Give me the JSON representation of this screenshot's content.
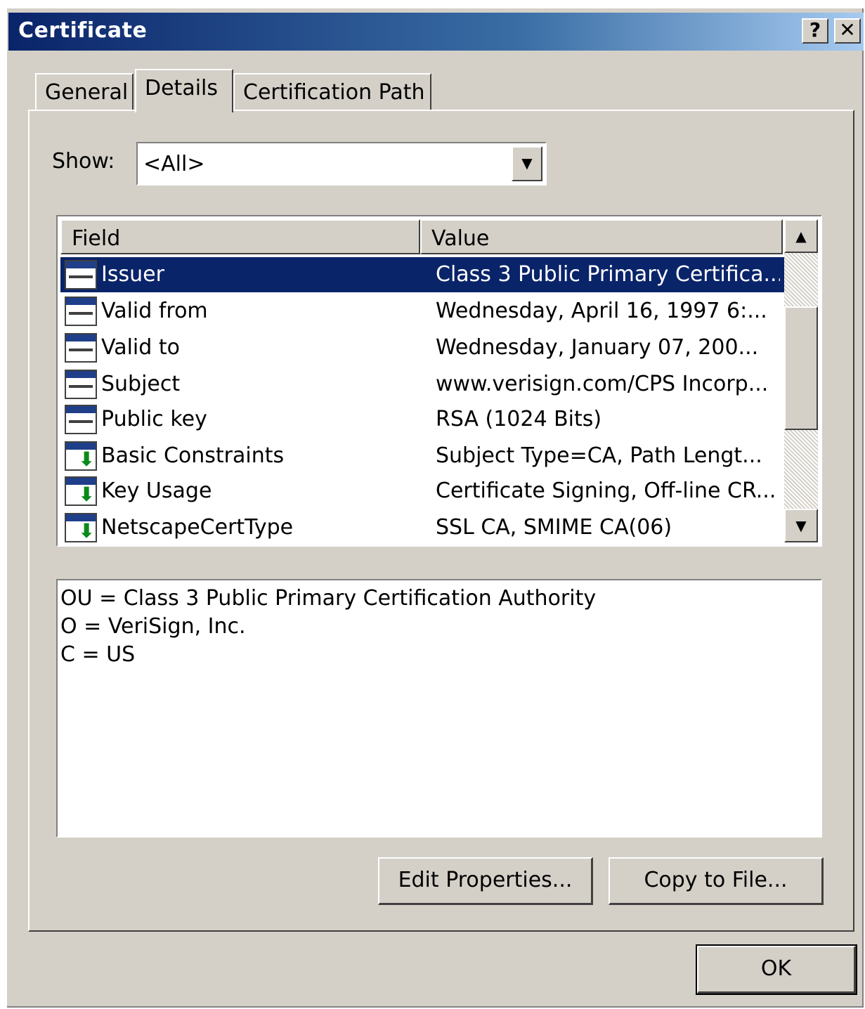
{
  "window": {
    "title": "Certificate",
    "help_label": "?",
    "close_label": "✕"
  },
  "tabs": [
    {
      "label": "General"
    },
    {
      "label": "Details"
    },
    {
      "label": "Certification Path"
    }
  ],
  "show": {
    "label": "Show:",
    "value": "<All>"
  },
  "list": {
    "columns": [
      "Field",
      "Value"
    ],
    "rows": [
      {
        "field": "Issuer",
        "value": "Class 3 Public Primary Certifica...",
        "icon": "certificate-field-icon",
        "selected": true
      },
      {
        "field": "Valid from",
        "value": "Wednesday, April 16, 1997 6:...",
        "icon": "certificate-field-icon"
      },
      {
        "field": "Valid to",
        "value": "Wednesday, January 07, 200...",
        "icon": "certificate-field-icon"
      },
      {
        "field": "Subject",
        "value": "www.verisign.com/CPS Incorp...",
        "icon": "certificate-field-icon"
      },
      {
        "field": "Public key",
        "value": "RSA (1024 Bits)",
        "icon": "certificate-field-icon"
      },
      {
        "field": "Basic Constraints",
        "value": "Subject Type=CA, Path Lengt...",
        "icon": "extension-icon"
      },
      {
        "field": "Key Usage",
        "value": "Certificate Signing, Off-line CR...",
        "icon": "extension-icon"
      },
      {
        "field": "NetscapeCertType",
        "value": "SSL CA, SMIME CA(06)",
        "icon": "extension-icon"
      }
    ]
  },
  "detail": {
    "lines": [
      "OU = Class 3 Public Primary Certification Authority",
      "O = VeriSign, Inc.",
      "C = US"
    ]
  },
  "buttons": {
    "edit_properties": "Edit Properties...",
    "copy_to_file": "Copy to File...",
    "ok": "OK"
  }
}
